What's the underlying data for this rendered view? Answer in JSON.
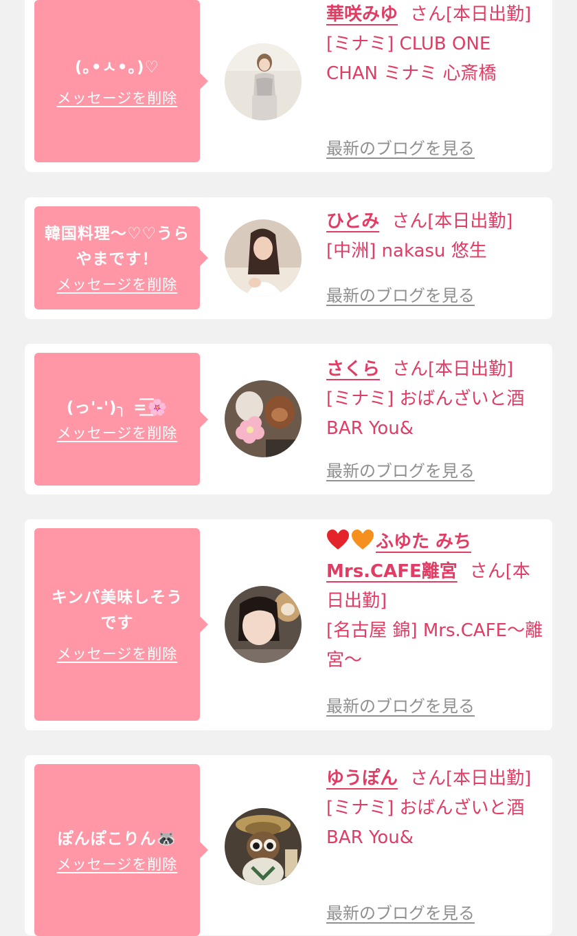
{
  "common": {
    "delete_label": "メッセージを削除",
    "blog_label": "最新のブログを見る",
    "san_label": "さん[本日出勤]"
  },
  "colors": {
    "page_bg": "#f1f1f1",
    "card_bg": "#ffffff",
    "bubble_bg": "#ff97a7",
    "accent": "#e03c64",
    "link_gray": "#8f8f8f"
  },
  "items": [
    {
      "message": "(｡•ㅅ•｡)♡",
      "name": "華咲みゆ",
      "shop": "[ミナミ] CLUB ONE CHAN ミナミ 心斎橋"
    },
    {
      "message": "韓国料理〜♡♡うらやまです！",
      "name": "ひとみ",
      "shop": "[中洲] nakasu 悠生"
    },
    {
      "message": "(っ'-')╮ =͟͟͞͞🌸",
      "name": "さくら",
      "shop": "[ミナミ] おばんざいと酒BAR You&"
    },
    {
      "message": "キンパ美味しそうです",
      "name": "ふゆた みちMrs.CAFE離宮",
      "shop": "[名古屋 錦] Mrs.CAFE〜離宮〜"
    },
    {
      "message": "ぽんぽこりん🦝",
      "name": "ゆうぽん",
      "shop": "[ミナミ] おばんざいと酒BAR You&"
    }
  ]
}
